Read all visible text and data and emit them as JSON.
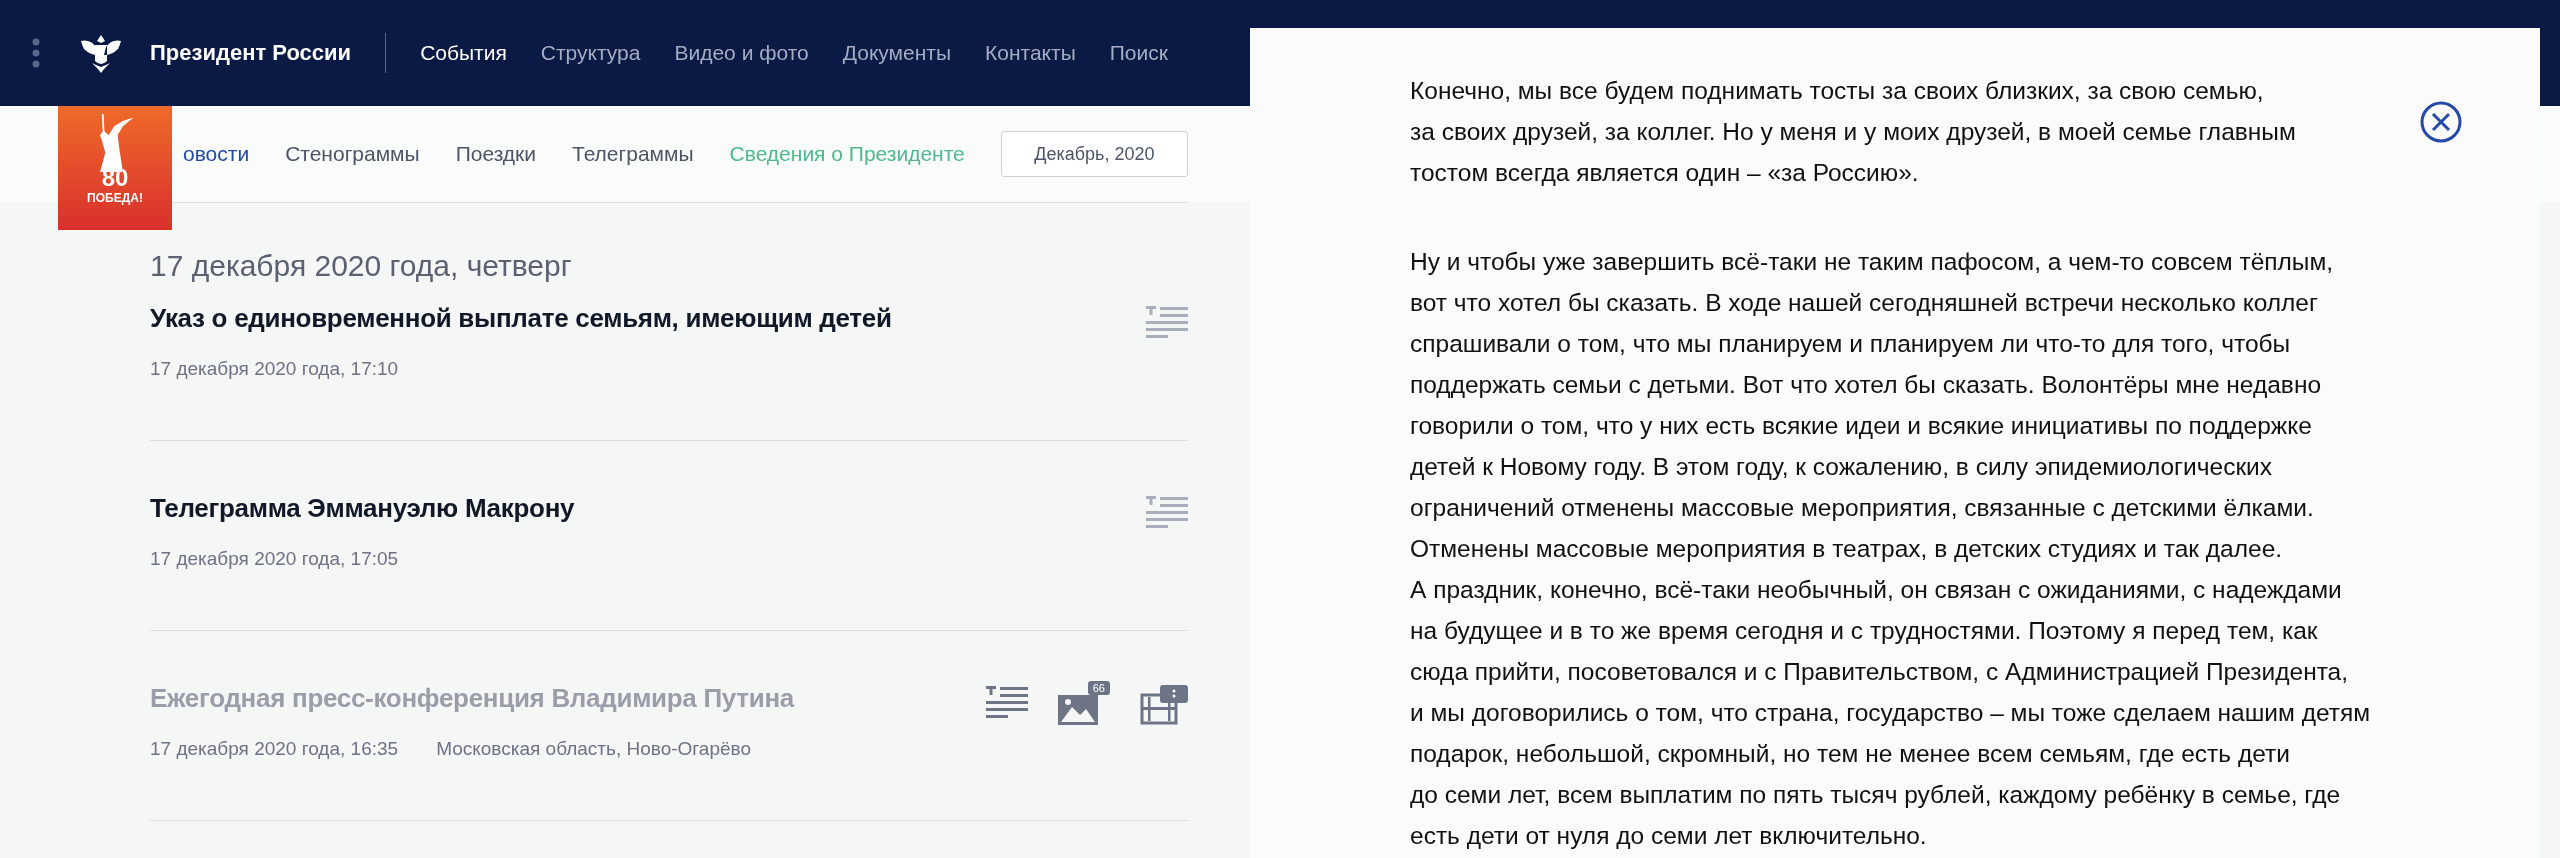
{
  "header": {
    "site_title": "Президент России",
    "nav": [
      {
        "label": "События",
        "selected": true
      },
      {
        "label": "Структура",
        "selected": false
      },
      {
        "label": "Видео и фото",
        "selected": false
      },
      {
        "label": "Документы",
        "selected": false
      },
      {
        "label": "Контакты",
        "selected": false
      },
      {
        "label": "Поиск",
        "selected": false
      }
    ]
  },
  "badge": {
    "number": "80",
    "caption": "ПОБЕДА!"
  },
  "subnav": {
    "tabs": [
      {
        "label": "овости",
        "selected": true,
        "kind": "section"
      },
      {
        "label": "Стенограммы",
        "selected": false,
        "kind": "section"
      },
      {
        "label": "Поездки",
        "selected": false,
        "kind": "section"
      },
      {
        "label": "Телеграммы",
        "selected": false,
        "kind": "section"
      },
      {
        "label": "Сведения о Президенте",
        "selected": false,
        "kind": "special"
      }
    ],
    "month_button": "Декабрь, 2020"
  },
  "feed": {
    "date_heading": "17 декабря 2020 года, четверг",
    "items": [
      {
        "title": "Указ о единовременной выплате семьям, имеющим детей",
        "time": "17 декабря 2020 года, 17:10",
        "read": false,
        "media": [
          {
            "kind": "text"
          }
        ]
      },
      {
        "title": "Телеграмма Эммануэлю Макрону",
        "time": "17 декабря 2020 года, 17:05",
        "read": false,
        "media": [
          {
            "kind": "text"
          }
        ]
      },
      {
        "title": "Ежегодная пресс-конференция Владимира Путина",
        "time": "17 декабря 2020 года, 16:35",
        "place": "Московская область, Ново-Огарёво",
        "read": true,
        "media": [
          {
            "kind": "text"
          },
          {
            "kind": "photo",
            "count": "66"
          },
          {
            "kind": "video"
          }
        ]
      }
    ]
  },
  "reader": {
    "paragraphs": [
      [
        "Конечно, мы все будем поднимать тосты за своих близких, за свою семью,",
        "за своих друзей, за коллег. Но у меня и у моих друзей, в моей семье главным",
        "тостом всегда является один – «за Россию»."
      ],
      [
        "Ну и чтобы уже завершить всё-таки не таким пафосом, а чем-то совсем тёплым,",
        "вот что хотел бы сказать. В ходе нашей сегодняшней встречи несколько коллег",
        "спрашивали о том, что мы планируем и планируем ли что-то для того, чтобы",
        "поддержать семьи с детьми. Вот что хотел бы сказать. Волонтёры мне недавно",
        "говорили о том, что у них есть всякие идеи и всякие инициативы по поддержке",
        "детей к Новому году. В этом году, к сожалению, в силу эпидемиологических",
        "ограничений отменены массовые мероприятия, связанные с детскими ёлками.",
        "Отменены массовые мероприятия в театрах, в детских студиях и так далее.",
        "А праздник, конечно, всё-таки необычный, он связан с ожиданиями, с надеждами",
        "на будущее и в то же время сегодня и с трудностями. Поэтому я перед тем, как",
        "сюда прийти, посоветовался и с Правительством, с Администрацией Президента,",
        "и мы договорились о том, что страна, государство – мы тоже сделаем нашим детям",
        "подарок, небольшой, скромный, но тем не менее всем семьям, где есть дети",
        "до семи лет, всем выплатим по пять тысяч рублей, каждому ребёнку в семье, где",
        "есть дети от нуля до семи лет включительно."
      ]
    ]
  }
}
